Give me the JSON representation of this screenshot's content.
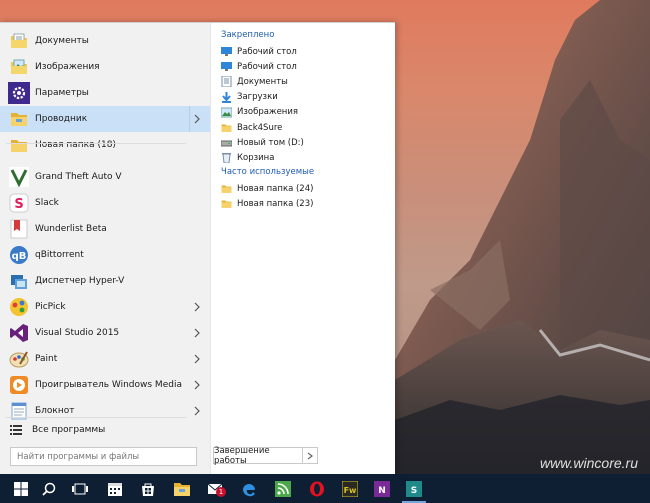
{
  "apps": [
    {
      "label": "Документы",
      "icon": "documents-folder-icon",
      "chevron": false,
      "selected": false
    },
    {
      "label": "Изображения",
      "icon": "pictures-folder-icon",
      "chevron": false,
      "selected": false
    },
    {
      "label": "Параметры",
      "icon": "settings-gear-icon",
      "chevron": false,
      "selected": false
    },
    {
      "label": "Проводник",
      "icon": "file-explorer-icon",
      "chevron": true,
      "selected": true
    },
    {
      "label": "Новая папка (18)",
      "icon": "folder-icon",
      "chevron": false,
      "selected": false
    },
    {
      "label": "Grand Theft Auto V",
      "icon": "gta-v-icon",
      "chevron": false,
      "selected": false
    },
    {
      "label": "Slack",
      "icon": "slack-icon",
      "chevron": false,
      "selected": false
    },
    {
      "label": "Wunderlist Beta",
      "icon": "wunderlist-icon",
      "chevron": false,
      "selected": false
    },
    {
      "label": "qBittorrent",
      "icon": "qbittorrent-icon",
      "chevron": false,
      "selected": false
    },
    {
      "label": "Диспетчер Hyper-V",
      "icon": "hyper-v-icon",
      "chevron": false,
      "selected": false
    },
    {
      "label": "PicPick",
      "icon": "picpick-icon",
      "chevron": true,
      "selected": false
    },
    {
      "label": "Visual Studio 2015",
      "icon": "visual-studio-icon",
      "chevron": true,
      "selected": false
    },
    {
      "label": "Paint",
      "icon": "paint-icon",
      "chevron": true,
      "selected": false
    },
    {
      "label": "Проигрыватель Windows Media",
      "icon": "windows-media-player-icon",
      "chevron": true,
      "selected": false
    },
    {
      "label": "Блокнот",
      "icon": "notepad-icon",
      "chevron": true,
      "selected": false
    }
  ],
  "all_apps_label": "Все программы",
  "search_placeholder": "Найти программы и файлы",
  "shutdown_label": "Завершение работы",
  "pinned": {
    "title": "Закреплено",
    "items": [
      {
        "label": "Рабочий стол",
        "icon": "desktop-icon"
      },
      {
        "label": "Рабочий стол",
        "icon": "desktop-icon"
      },
      {
        "label": "Документы",
        "icon": "documents-icon"
      },
      {
        "label": "Загрузки",
        "icon": "downloads-icon"
      },
      {
        "label": "Изображения",
        "icon": "pictures-icon"
      },
      {
        "label": "Back4Sure",
        "icon": "folder-icon"
      },
      {
        "label": "Новый том (D:)",
        "icon": "drive-icon"
      },
      {
        "label": "Корзина",
        "icon": "recycle-bin-icon"
      }
    ]
  },
  "frequent": {
    "title": "Часто используемые",
    "items": [
      {
        "label": "Новая папка (24)",
        "icon": "folder-icon"
      },
      {
        "label": "Новая папка (23)",
        "icon": "folder-icon"
      }
    ]
  },
  "taskbar": {
    "items": [
      {
        "icon": "windows-start-icon",
        "active": false
      },
      {
        "icon": "search-icon",
        "active": false
      },
      {
        "icon": "task-view-icon",
        "active": false
      },
      {
        "icon": "calendar-icon",
        "active": false
      },
      {
        "icon": "store-icon",
        "active": false
      },
      {
        "icon": "file-explorer-icon",
        "active": false
      },
      {
        "icon": "mail-icon",
        "active": false,
        "badge": "1"
      },
      {
        "icon": "edge-icon",
        "active": false
      },
      {
        "icon": "feed-reader-icon",
        "active": false
      },
      {
        "icon": "opera-icon",
        "active": false
      },
      {
        "icon": "fireworks-icon",
        "active": false
      },
      {
        "icon": "onenote-icon",
        "active": false
      },
      {
        "icon": "sway-icon",
        "active": true
      }
    ]
  },
  "watermark": "www.wincore.ru",
  "colors": {
    "accent": "#1f5bb5",
    "selection": "#c9e0f7",
    "taskbar": "#0e1f33"
  }
}
